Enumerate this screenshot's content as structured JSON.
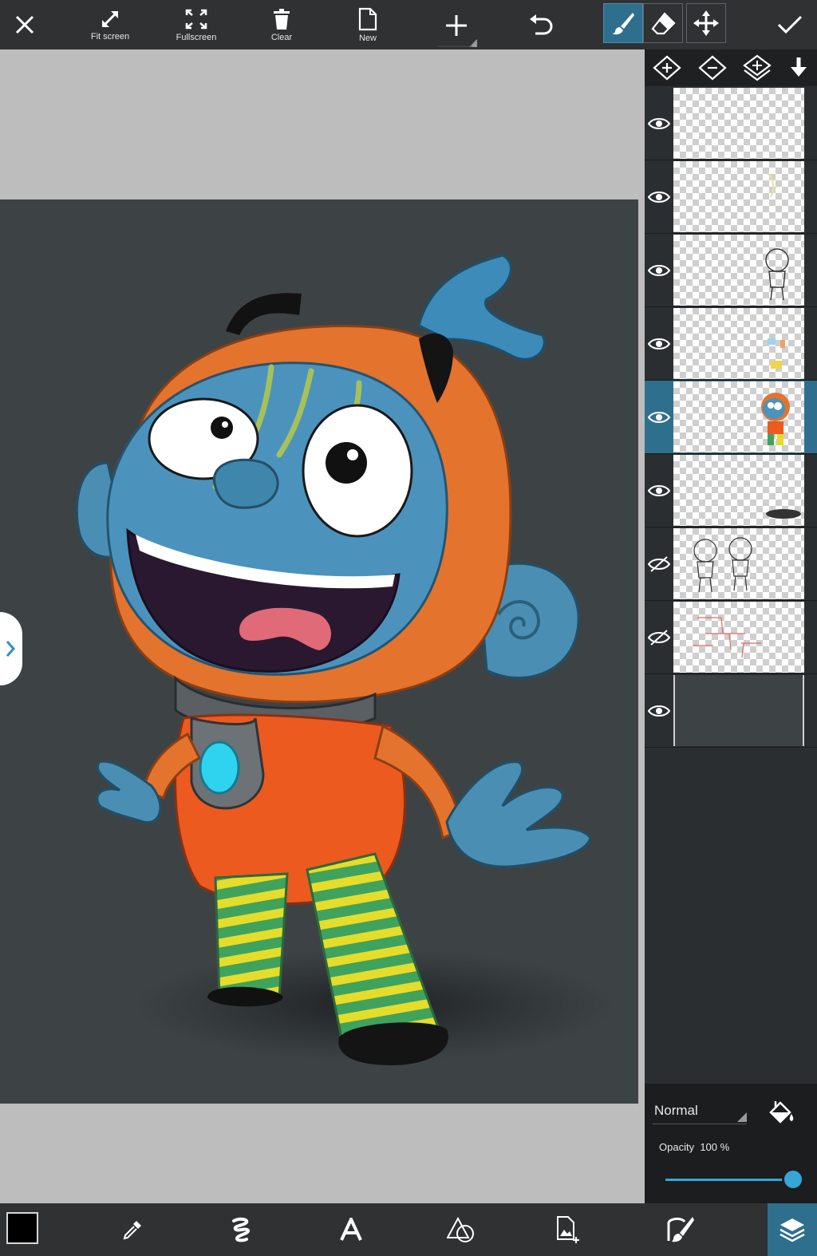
{
  "toolbar": {
    "close_icon": "close-icon",
    "fit_screen_label": "Fit screen",
    "fullscreen_label": "Fullscreen",
    "clear_label": "Clear",
    "new_label": "New",
    "add_icon": "plus-icon",
    "undo_icon": "undo-icon",
    "tools": [
      "brush-icon",
      "eraser-icon",
      "move-icon"
    ],
    "active_tool": "brush",
    "confirm_icon": "check-icon"
  },
  "layer_tools": [
    "add-layer-icon",
    "remove-layer-icon",
    "duplicate-layer-icon",
    "merge-down-icon"
  ],
  "layers": [
    {
      "visible": true,
      "selected": false
    },
    {
      "visible": true,
      "selected": false
    },
    {
      "visible": true,
      "selected": false
    },
    {
      "visible": true,
      "selected": false
    },
    {
      "visible": true,
      "selected": true
    },
    {
      "visible": true,
      "selected": false
    },
    {
      "visible": false,
      "selected": false
    },
    {
      "visible": false,
      "selected": false
    },
    {
      "visible": true,
      "selected": false,
      "background": true
    }
  ],
  "layer_props": {
    "blend_mode": "Normal",
    "opacity_label": "Opacity",
    "opacity_value": "100 %",
    "opacity_fraction": 1.0
  },
  "bottom_tools": [
    "color-swatch",
    "eyedropper-icon",
    "brush-stroke-icon",
    "text-icon",
    "shapes-icon",
    "add-image-icon",
    "brush-settings-icon",
    "layers-icon"
  ],
  "colors": {
    "accent": "#2e6f8e",
    "slider": "#35a6d6",
    "primary_color": "#000000"
  }
}
